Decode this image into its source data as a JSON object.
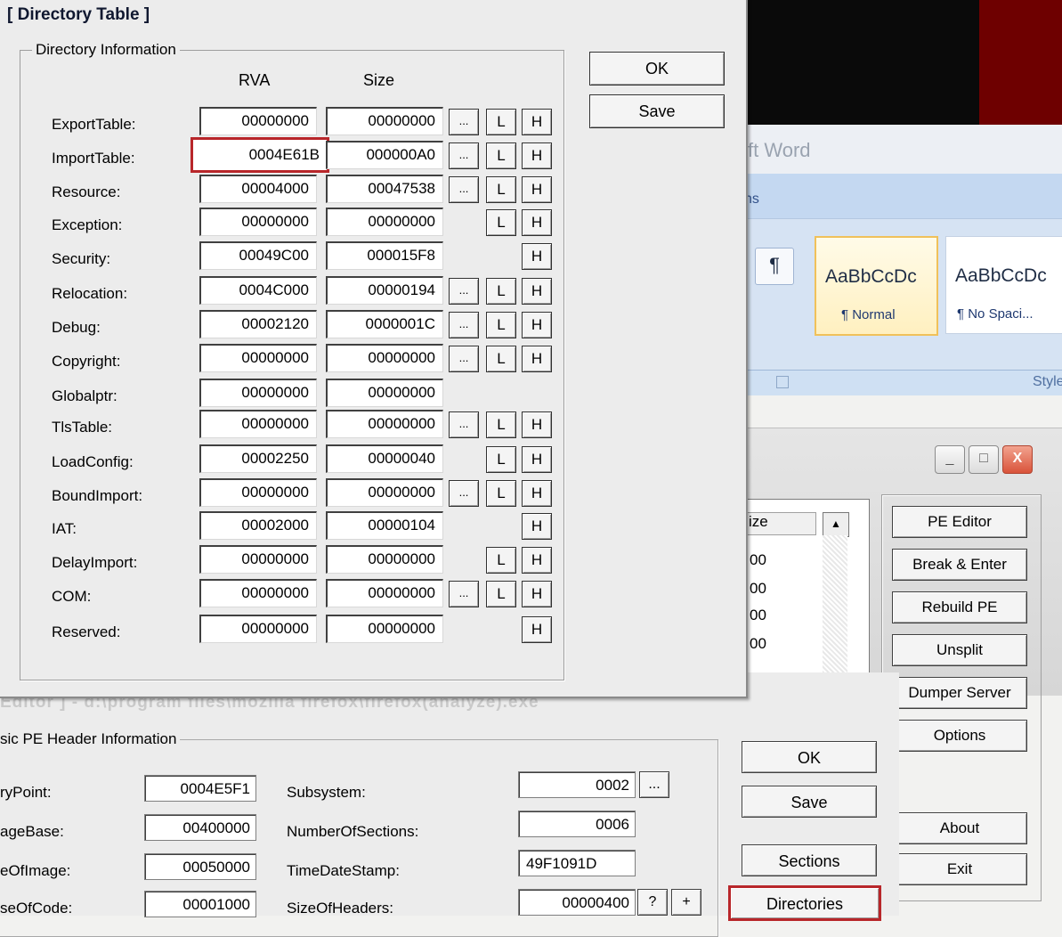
{
  "word": {
    "title_fragment": "ft Word",
    "tab_fragment": "ns",
    "pilcrow": "¶",
    "styles": [
      {
        "sample": "AaBbCcDc",
        "name": "¶ Normal"
      },
      {
        "sample": "AaBbCcDc",
        "name": "¶ No Spaci..."
      }
    ],
    "styles_group_label": "Style"
  },
  "main_window": {
    "controls": [
      "_",
      "□",
      "X"
    ],
    "list_header": "ize",
    "list_rows": [
      "00",
      "00",
      "00",
      "00"
    ],
    "buttons": [
      "PE Editor",
      "Break & Enter",
      "Rebuild PE",
      "Unsplit",
      "Dumper Server",
      "Options",
      "About",
      "Exit"
    ]
  },
  "pe_editor": {
    "title_fragment": "Editor ] - d:\\program files\\mozilla firefox\\firefox(analyze).exe",
    "group_label": "sic PE Header Information",
    "left_fields": [
      {
        "label": "ryPoint:",
        "value": "0004E5F1"
      },
      {
        "label": "ageBase:",
        "value": "00400000"
      },
      {
        "label": "eOfImage:",
        "value": "00050000"
      },
      {
        "label": "seOfCode:",
        "value": "00001000"
      }
    ],
    "right_fields": [
      {
        "label": "Subsystem:",
        "value": "0002"
      },
      {
        "label": "NumberOfSections:",
        "value": "0006"
      },
      {
        "label": "TimeDateStamp:",
        "value": "49F1091D"
      },
      {
        "label": "SizeOfHeaders:",
        "value": "00000400"
      }
    ],
    "dots_label": "...",
    "question_label": "?",
    "plus_label": "+",
    "buttons": [
      "OK",
      "Save",
      "Sections",
      "Directories"
    ]
  },
  "directory_dialog": {
    "title": "[ Directory Table ]",
    "group_label": "Directory Information",
    "col_rva": "RVA",
    "col_size": "Size",
    "ok_label": "OK",
    "save_label": "Save",
    "dots_label": "...",
    "l_label": "L",
    "h_label": "H",
    "rows": [
      {
        "label": "ExportTable:",
        "rva": "00000000",
        "size": "00000000"
      },
      {
        "label": "ImportTable:",
        "rva": "0004E61B",
        "size": "000000A0"
      },
      {
        "label": "Resource:",
        "rva": "00004000",
        "size": "00047538"
      },
      {
        "label": "Exception:",
        "rva": "00000000",
        "size": "00000000"
      },
      {
        "label": "Security:",
        "rva": "00049C00",
        "size": "000015F8"
      },
      {
        "label": "Relocation:",
        "rva": "0004C000",
        "size": "00000194"
      },
      {
        "label": "Debug:",
        "rva": "00002120",
        "size": "0000001C"
      },
      {
        "label": "Copyright:",
        "rva": "00000000",
        "size": "00000000"
      },
      {
        "label": "Globalptr:",
        "rva": "00000000",
        "size": "00000000"
      },
      {
        "label": "TlsTable:",
        "rva": "00000000",
        "size": "00000000"
      },
      {
        "label": "LoadConfig:",
        "rva": "00002250",
        "size": "00000040"
      },
      {
        "label": "BoundImport:",
        "rva": "00000000",
        "size": "00000000"
      },
      {
        "label": "IAT:",
        "rva": "00002000",
        "size": "00000104"
      },
      {
        "label": "DelayImport:",
        "rva": "00000000",
        "size": "00000000"
      },
      {
        "label": "COM:",
        "rva": "00000000",
        "size": "00000000"
      },
      {
        "label": "Reserved:",
        "rva": "00000000",
        "size": "00000000"
      }
    ]
  }
}
